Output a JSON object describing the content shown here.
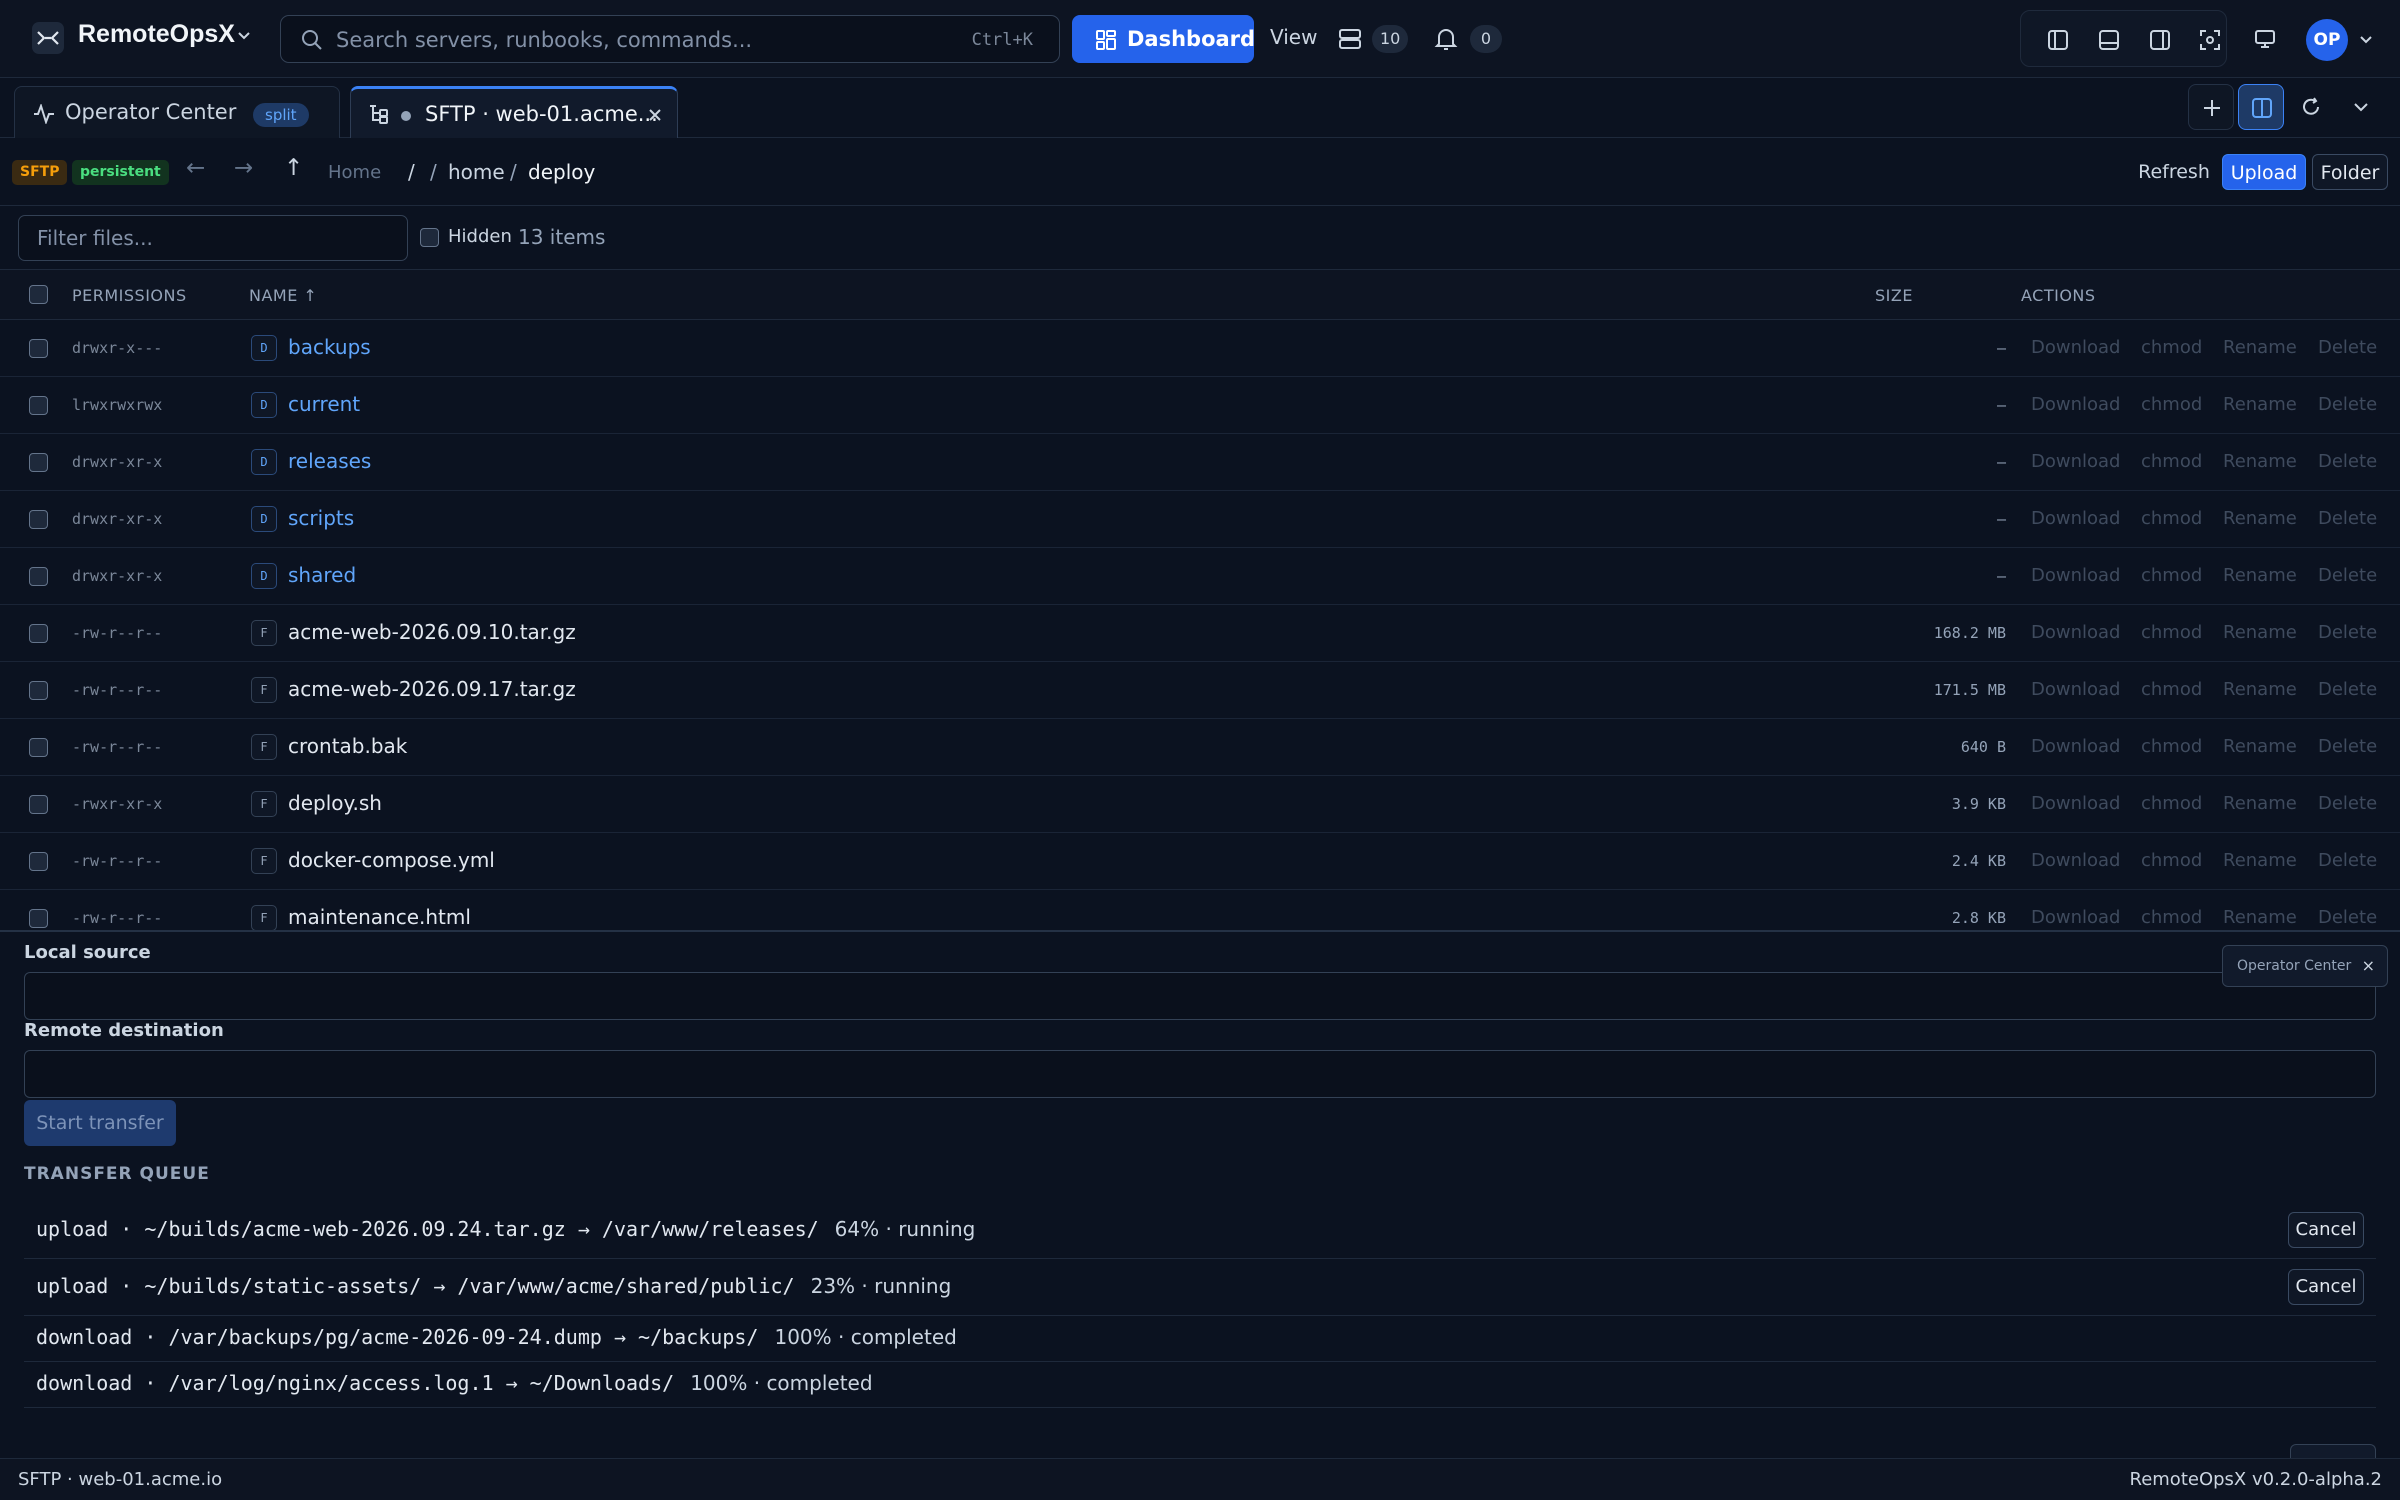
{
  "app": {
    "title": "RemoteOpsX"
  },
  "search": {
    "placeholder": "Search servers, runbooks, commands...",
    "shortcut": "Ctrl+K"
  },
  "toolbar": {
    "dashboard_label": "Dashboard",
    "view_label": "View",
    "servers_count": "10",
    "notifications_count": "0",
    "avatar_initials": "OP"
  },
  "tabs": [
    {
      "label": "Operator Center",
      "badge": "split"
    },
    {
      "label": "SFTP · web-01.acme..."
    }
  ],
  "pathbar": {
    "protocol_badge": "SFTP",
    "session_badge": "persistent",
    "back": "←",
    "forward": "→",
    "up": "↑",
    "home": "Home",
    "root": "/",
    "sep1": "/",
    "seg1": "home",
    "sep2": "/",
    "seg2": "deploy",
    "refresh_label": "Refresh",
    "upload_label": "Upload",
    "folder_label": "Folder"
  },
  "filter": {
    "placeholder": "Filter files...",
    "hidden_label": "Hidden",
    "item_count": "13 items"
  },
  "table": {
    "headers": {
      "permissions": "PERMISSIONS",
      "name": "NAME ↑",
      "size": "SIZE",
      "actions": "ACTIONS"
    },
    "action_labels": {
      "download": "Download",
      "chmod": "chmod",
      "rename": "Rename",
      "delete": "Delete"
    },
    "rows": [
      {
        "perm": "drwxr-x---",
        "type": "D",
        "name": "backups",
        "size": "–"
      },
      {
        "perm": "lrwxrwxrwx",
        "type": "D",
        "name": "current",
        "size": "–"
      },
      {
        "perm": "drwxr-xr-x",
        "type": "D",
        "name": "releases",
        "size": "–"
      },
      {
        "perm": "drwxr-xr-x",
        "type": "D",
        "name": "scripts",
        "size": "–"
      },
      {
        "perm": "drwxr-xr-x",
        "type": "D",
        "name": "shared",
        "size": "–"
      },
      {
        "perm": "-rw-r--r--",
        "type": "F",
        "name": "acme-web-2026.09.10.tar.gz",
        "size": "168.2 MB"
      },
      {
        "perm": "-rw-r--r--",
        "type": "F",
        "name": "acme-web-2026.09.17.tar.gz",
        "size": "171.5 MB"
      },
      {
        "perm": "-rw-r--r--",
        "type": "F",
        "name": "crontab.bak",
        "size": "640 B"
      },
      {
        "perm": "-rwxr-xr-x",
        "type": "F",
        "name": "deploy.sh",
        "size": "3.9 KB"
      },
      {
        "perm": "-rw-r--r--",
        "type": "F",
        "name": "docker-compose.yml",
        "size": "2.4 KB"
      },
      {
        "perm": "-rw-r--r--",
        "type": "F",
        "name": "maintenance.html",
        "size": "2.8 KB"
      }
    ]
  },
  "transfer": {
    "local_label": "Local source",
    "remote_label": "Remote destination",
    "start_label": "Start transfer",
    "queue_title": "TRANSFER QUEUE",
    "cancel_label": "Cancel",
    "queue": [
      {
        "desc": "upload · ~/builds/acme-web-2026.09.24.tar.gz → /var/www/releases/",
        "status": "64% · running",
        "cancellable": true
      },
      {
        "desc": "upload · ~/builds/static-assets/ → /var/www/acme/shared/public/",
        "status": "23% · running",
        "cancellable": true
      },
      {
        "desc": "download · /var/backups/pg/acme-2026-09-24.dump → ~/backups/",
        "status": "100% · completed",
        "cancellable": false
      },
      {
        "desc": "download · /var/log/nginx/access.log.1 → ~/Downloads/",
        "status": "100% · completed",
        "cancellable": false
      }
    ],
    "toast_label": "Operator Center",
    "toast_close": "×"
  },
  "status": {
    "left": "SFTP · web-01.acme.io",
    "right": "RemoteOpsX v0.2.0-alpha.2"
  },
  "colors": {
    "accent": "#2563eb",
    "directory": "#60a5fa",
    "protocol": "#f59e0b",
    "session": "#4ade80"
  }
}
